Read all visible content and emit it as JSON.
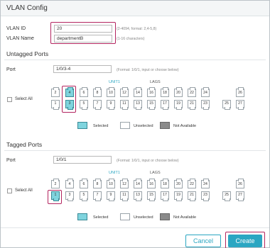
{
  "window": {
    "title": "VLAN Config"
  },
  "vlan_id": {
    "label": "VLAN ID",
    "value": "20",
    "hint": "(2-4094, format: 2,4-5,8)"
  },
  "vlan_name": {
    "label": "VLAN Name",
    "value": "departmentB",
    "hint": "(1-16 characters)"
  },
  "untagged": {
    "title": "Untagged Ports",
    "port_label": "Port",
    "port_value": "1/0/3-4",
    "port_hint": "(Format: 1/0/1, input or choose below)",
    "unit_label": "UNIT1",
    "lags_label": "LAGS",
    "select_all": "Select All",
    "top_ports": [
      "2",
      "4",
      "6",
      "8",
      "10",
      "12",
      "14",
      "16",
      "18",
      "20",
      "22",
      "24",
      "26"
    ],
    "bottom_ports": [
      "1",
      "3",
      "5",
      "7",
      "9",
      "11",
      "13",
      "15",
      "17",
      "19",
      "21",
      "23",
      "25",
      "27"
    ],
    "selected": [
      "3",
      "4"
    ]
  },
  "tagged": {
    "title": "Tagged Ports",
    "port_label": "Port",
    "port_value": "1/0/1",
    "port_hint": "(Format: 1/0/1, input or choose below)",
    "unit_label": "UNIT1",
    "lags_label": "LAGS",
    "select_all": "Select All",
    "top_ports": [
      "2",
      "4",
      "6",
      "8",
      "10",
      "12",
      "14",
      "16",
      "18",
      "20",
      "22",
      "24",
      "26"
    ],
    "bottom_ports": [
      "1",
      "3",
      "5",
      "7",
      "9",
      "11",
      "13",
      "15",
      "17",
      "19",
      "21",
      "23",
      "25",
      "27"
    ],
    "selected": [
      "1"
    ]
  },
  "legend": {
    "selected": "Selected",
    "unselected": "Unselected",
    "not_available": "Not Available"
  },
  "buttons": {
    "cancel": "Cancel",
    "create": "Create"
  },
  "colors": {
    "accent": "#2aa6c2",
    "highlight": "#b3245f",
    "port_selected": "#7fd4de"
  }
}
